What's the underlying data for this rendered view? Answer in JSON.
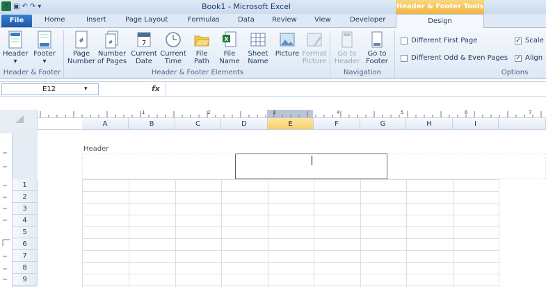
{
  "window": {
    "title": "Book1 - Microsoft Excel",
    "context_group": "Header & Footer Tools"
  },
  "tabs": [
    "File",
    "Home",
    "Insert",
    "Page Layout",
    "Formulas",
    "Data",
    "Review",
    "View",
    "Developer",
    "Design"
  ],
  "ribbon": {
    "groups": {
      "header_footer": "Header & Footer",
      "elements": "Header & Footer Elements",
      "navigation": "Navigation",
      "options": "Options"
    },
    "buttons": {
      "header": "Header",
      "footer": "Footer",
      "page_number": [
        "Page",
        "Number"
      ],
      "number_of_pages": [
        "Number",
        "of Pages"
      ],
      "current_date": [
        "Current",
        "Date"
      ],
      "current_time": [
        "Current",
        "Time"
      ],
      "file_path": [
        "File",
        "Path"
      ],
      "file_name": [
        "File",
        "Name"
      ],
      "sheet_name": [
        "Sheet",
        "Name"
      ],
      "picture": "Picture",
      "format_picture": [
        "Format",
        "Picture"
      ],
      "goto_header": [
        "Go to",
        "Header"
      ],
      "goto_footer": [
        "Go to",
        "Footer"
      ]
    },
    "options": {
      "different_first_page": {
        "label": "Different First Page",
        "checked": false
      },
      "different_odd_even": {
        "label": "Different Odd & Even Pages",
        "checked": false
      },
      "scale": {
        "label": "Scale",
        "checked": true
      },
      "align": {
        "label": "Align",
        "checked": true
      }
    }
  },
  "formula_bar": {
    "name_box": "E12",
    "fx": "fx",
    "value": ""
  },
  "columns": [
    "A",
    "B",
    "C",
    "D",
    "E",
    "F",
    "G",
    "H",
    "I"
  ],
  "selected_column": "E",
  "rows": [
    "1",
    "2",
    "3",
    "4",
    "5",
    "6",
    "7",
    "8",
    "9"
  ],
  "ruler_marks": [
    "1",
    "2",
    "3",
    "4",
    "5",
    "6",
    "7"
  ],
  "page": {
    "header_label": "Header"
  }
}
